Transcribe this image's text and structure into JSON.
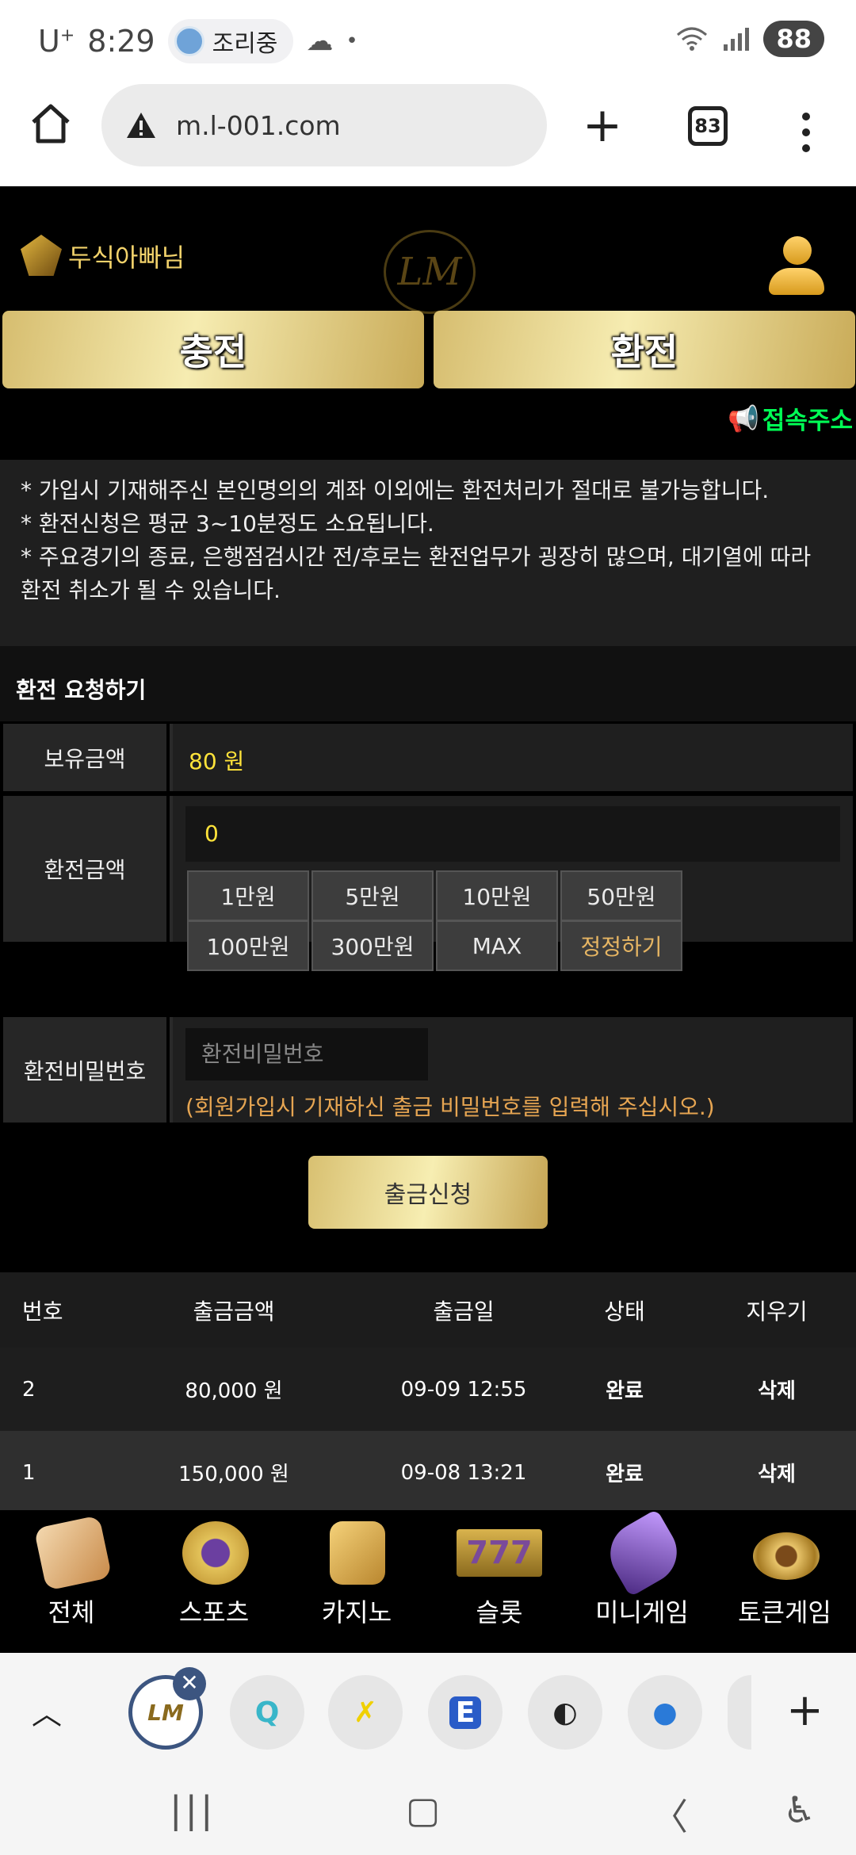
{
  "status_bar": {
    "carrier": "U",
    "carrier_sup": "+",
    "time": "8:29",
    "notification_app": "조리중",
    "battery": "88"
  },
  "browser": {
    "url": "m.l-001.com",
    "tab_count": "83"
  },
  "site": {
    "username": "두식아빠님",
    "logo_text": "LM",
    "deposit_label": "충전",
    "withdraw_label": "환전",
    "notice_link": "접속주소",
    "notices": [
      "* 가입시 기재해주신 본인명의의 계좌 이외에는 환전처리가 절대로 불가능합니다.",
      "* 환전신청은 평균 3~10분정도 소요됩니다.",
      "* 주요경기의 종료, 은행점검시간 전/후로는 환전업무가 굉장히 많으며, 대기열에 따라 환전 취소가 될 수 있습니다."
    ],
    "section_title": "환전 요청하기",
    "balance_label": "보유금액",
    "balance_value": "80 원",
    "amount_label": "환전금액",
    "amount_value": "0",
    "chips": [
      "1만원",
      "5만원",
      "10만원",
      "50만원",
      "100만원",
      "300만원",
      "MAX",
      "정정하기"
    ],
    "password_label": "환전비밀번호",
    "password_placeholder": "환전비밀번호",
    "password_hint": "(회원가입시 기재하신 출금 비밀번호를 입력해 주십시오.)",
    "submit_label": "출금신청"
  },
  "history": {
    "headers": [
      "번호",
      "출금금액",
      "출금일",
      "상태",
      "지우기"
    ],
    "rows": [
      {
        "no": "2",
        "amount": "80,000 원",
        "date": "09-09 12:55",
        "status": "완료",
        "action": "삭제"
      },
      {
        "no": "1",
        "amount": "150,000 원",
        "date": "09-08 13:21",
        "status": "완료",
        "action": "삭제"
      }
    ]
  },
  "game_nav": [
    {
      "label": "전체",
      "icon": "dice-icon"
    },
    {
      "label": "스포츠",
      "icon": "soccer-ball-icon"
    },
    {
      "label": "카지노",
      "icon": "cards-icon"
    },
    {
      "label": "슬롯",
      "icon": "slot-777-icon"
    },
    {
      "label": "미니게임",
      "icon": "rocket-icon"
    },
    {
      "label": "토큰게임",
      "icon": "roulette-icon"
    }
  ],
  "colors": {
    "gold": "#d6bd6f",
    "username": "#f2d26b",
    "notice_link": "#00ff55",
    "amount_yellow": "#ffe33a",
    "hint_orange": "#e6a552"
  }
}
